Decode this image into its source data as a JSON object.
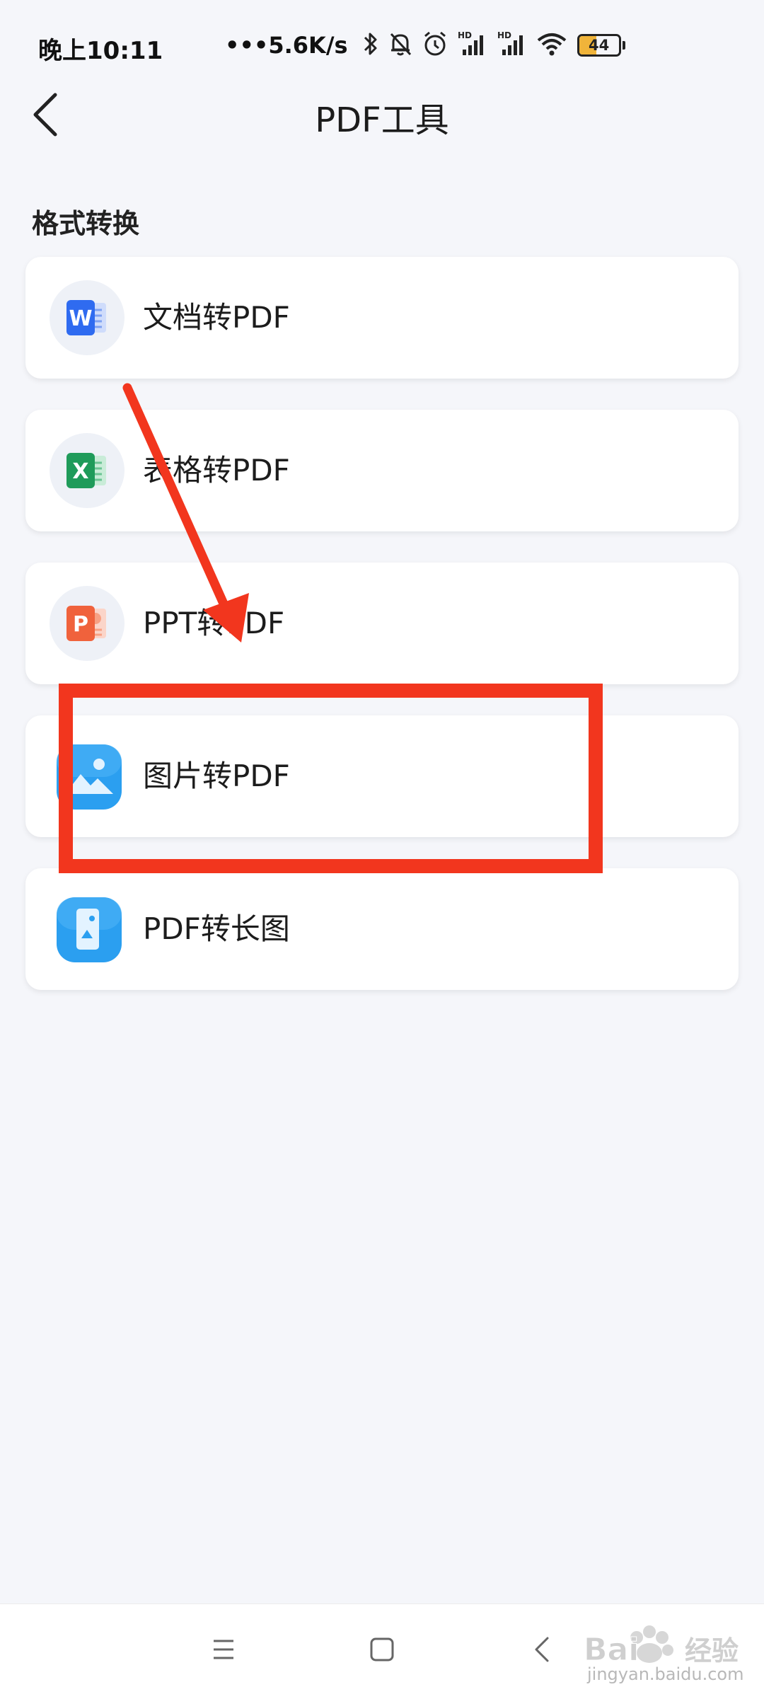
{
  "status_bar": {
    "time": "晚上10:11",
    "net_speed": "•••5.6K/s",
    "battery_level": "44",
    "battery_percent": 44,
    "icons": [
      "bluetooth-icon",
      "bell-off-icon",
      "alarm-icon",
      "hd-signal-icon",
      "hd-signal-icon",
      "wifi-icon",
      "battery-icon"
    ]
  },
  "header": {
    "title": "PDF工具",
    "back_icon": "chevron-left-icon"
  },
  "section": {
    "title": "格式转换"
  },
  "items": [
    {
      "label": "文档转PDF",
      "icon": "word-doc-icon",
      "color": "#2f6bf0"
    },
    {
      "label": "表格转PDF",
      "icon": "excel-sheet-icon",
      "color": "#1f9b5a"
    },
    {
      "label": "PPT转PDF",
      "icon": "ppt-slide-icon",
      "color": "#f0623c"
    },
    {
      "label": "图片转PDF",
      "icon": "image-icon",
      "color": "#2b9ff0"
    },
    {
      "label": "PDF转长图",
      "icon": "long-image-icon",
      "color": "#2b9ff0"
    }
  ],
  "annotation": {
    "color": "#f2361e",
    "highlighted_item": "图片转PDF"
  },
  "nav_bar": {
    "icons": [
      "menu-icon",
      "home-square-icon",
      "back-chevron-icon"
    ]
  },
  "watermark": {
    "brand": "Baidu经验",
    "url": "jingyan.baidu.com"
  }
}
